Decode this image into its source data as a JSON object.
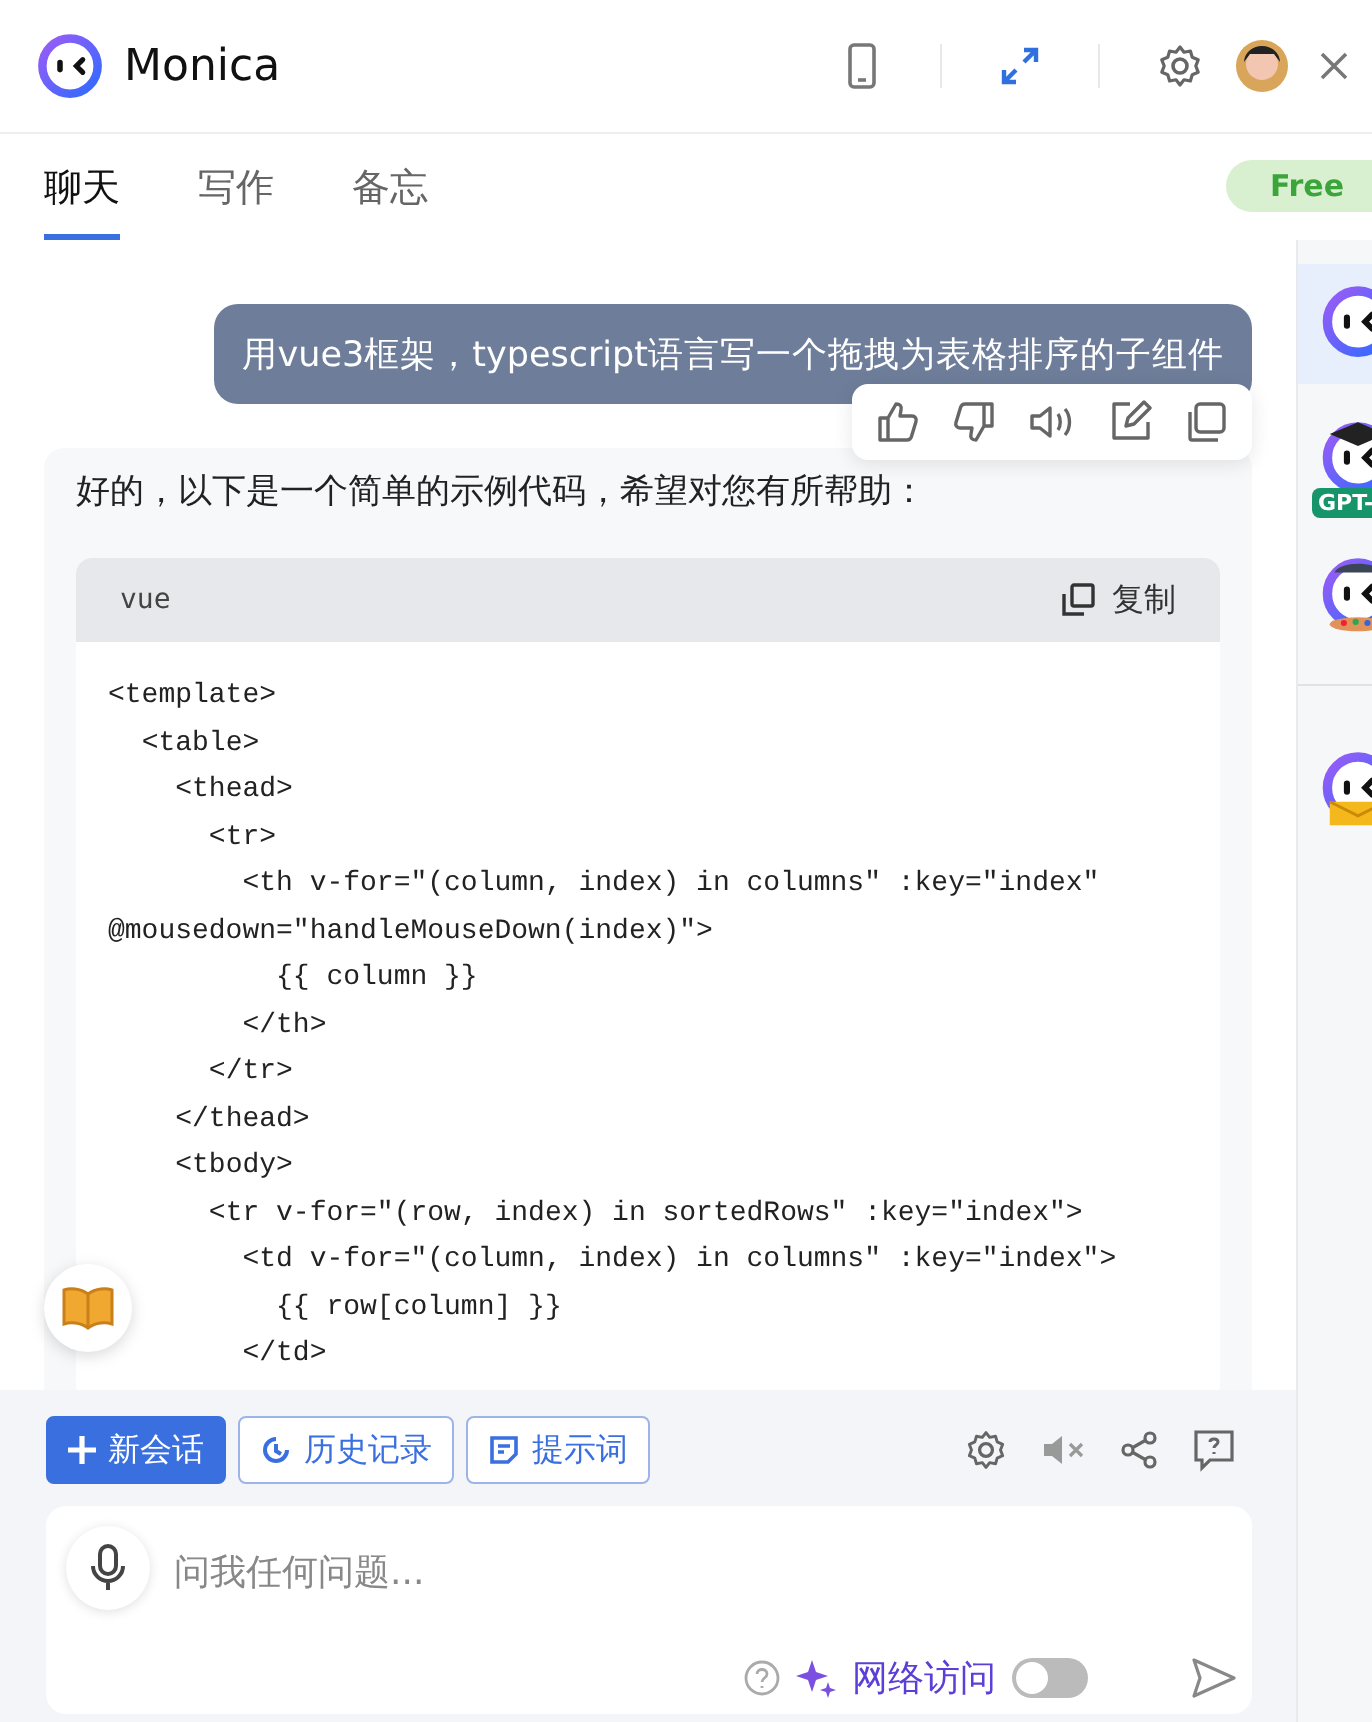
{
  "header": {
    "title": "Monica"
  },
  "tabs": [
    {
      "label": "聊天",
      "selected": true
    },
    {
      "label": "写作",
      "selected": false
    },
    {
      "label": "备忘",
      "selected": false
    }
  ],
  "plan_badge": "Free",
  "chat": {
    "user_message": "用vue3框架，typescript语言写一个拖拽为表格排序的子组件",
    "reply_intro": "好的，以下是一个简单的示例代码，希望对您有所帮助：",
    "code_block": {
      "language": "vue",
      "copy_label": "复制",
      "lines": [
        "<template>",
        "  <table>",
        "    <thead>",
        "      <tr>",
        "        <th v-for=\"(column, index) in columns\" :key=\"index\" @mousedown=\"handleMouseDown(index)\">",
        "          {{ column }}",
        "        </th>",
        "      </tr>",
        "    </thead>",
        "    <tbody>",
        "      <tr v-for=\"(row, index) in sortedRows\" :key=\"index\">",
        "        <td v-for=\"(column, index) in columns\" :key=\"index\">",
        "          {{ row[column] }}",
        "        </td>"
      ]
    }
  },
  "sidebar": {
    "bots": [
      {
        "kind": "plain",
        "selected": true
      },
      {
        "kind": "graduate",
        "selected": false,
        "badge": "GPT-"
      },
      {
        "kind": "artist",
        "selected": false
      },
      {
        "kind": "mail",
        "selected": false
      }
    ]
  },
  "toolbar": {
    "buttons": [
      {
        "kind": "new",
        "label": "新会话"
      },
      {
        "kind": "history",
        "label": "历史记录"
      },
      {
        "kind": "prompt",
        "label": "提示词"
      }
    ]
  },
  "composer": {
    "placeholder": "问我任何问题...",
    "web_access": {
      "label": "网络访问",
      "on": false
    }
  }
}
